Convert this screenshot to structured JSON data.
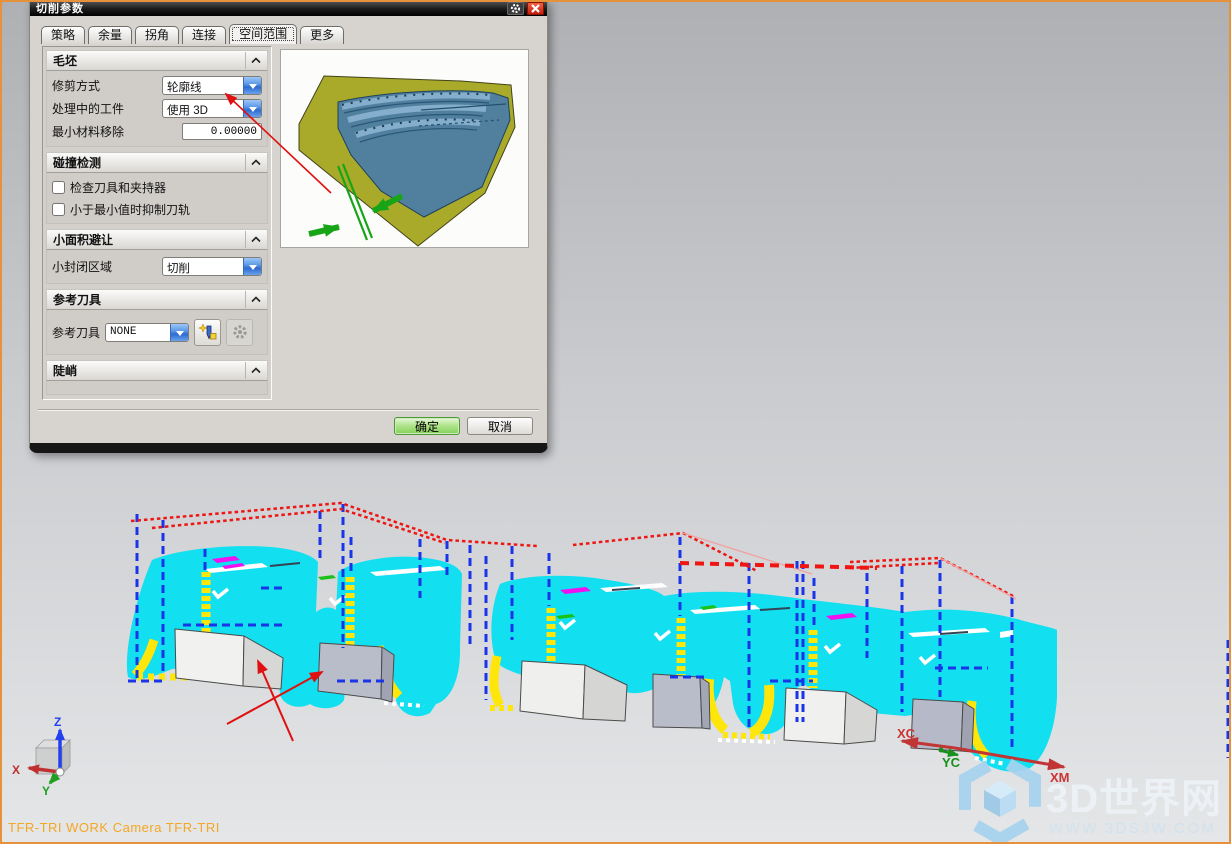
{
  "window": {
    "status_text": "TFR-TRI WORK Camera TFR-TRI"
  },
  "dialog": {
    "title": "切削参数",
    "tabs": [
      {
        "label": "策略",
        "active": false
      },
      {
        "label": "余量",
        "active": false
      },
      {
        "label": "拐角",
        "active": false
      },
      {
        "label": "连接",
        "active": false
      },
      {
        "label": "空间范围",
        "active": true
      },
      {
        "label": "更多",
        "active": false
      }
    ],
    "sections": {
      "blank": {
        "title": "毛坯",
        "rows": [
          {
            "label": "修剪方式",
            "value": "轮廓线"
          },
          {
            "label": "处理中的工件",
            "value": "使用 3D"
          },
          {
            "label": "最小材料移除",
            "value": "0.00000"
          }
        ]
      },
      "collision": {
        "title": "碰撞检测",
        "checkboxes": [
          {
            "label": "检查刀具和夹持器",
            "checked": false
          },
          {
            "label": "小于最小值时抑制刀轨",
            "checked": false
          }
        ]
      },
      "small_area": {
        "title": "小面积避让",
        "row": {
          "label": "小封闭区域",
          "value": "切削"
        }
      },
      "ref_tool": {
        "title": "参考刀具",
        "row": {
          "label": "参考刀具",
          "value": "NONE"
        }
      },
      "steep": {
        "title": "陡峭"
      }
    },
    "buttons": {
      "ok": "确定",
      "cancel": "取消"
    }
  },
  "viewport": {
    "triad": {
      "x": "X",
      "y": "Y",
      "z": "Z"
    },
    "wcs": {
      "xc": "XC",
      "yc": "YC",
      "xm": "XM"
    },
    "watermark": {
      "title": "3D世界网",
      "url": "WWW.3DSJW.COM"
    }
  },
  "icons": {
    "gear": "gear-icon",
    "close": "close-icon",
    "combo_arrow": "chevron-down-icon",
    "collapse": "chevron-up-icon",
    "new_tool": "new-tool-icon",
    "tool_settings": "tool-settings-icon"
  },
  "colors": {
    "toolpath_cyan": "#12dff0",
    "boundary_blue": "#1a35e8",
    "boundary_red": "#ee1512",
    "highlight_yellow": "#ffe60a",
    "ok_button_green": "#84d158",
    "status_orange": "#f5a623",
    "watermark_blue": "#a6d2ee",
    "frame_orange": "#e6913c"
  }
}
